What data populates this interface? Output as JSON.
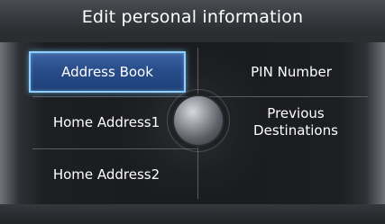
{
  "header": {
    "title": "Edit personal information"
  },
  "menu": {
    "items": [
      {
        "label": "Address Book",
        "selected": true
      },
      {
        "label": "PIN Number",
        "selected": false
      },
      {
        "label": "Home Address1",
        "selected": false
      },
      {
        "label": "Previous Destinations",
        "selected": false
      },
      {
        "label": "Home Address2",
        "selected": false
      }
    ]
  },
  "colors": {
    "selected_fill": "#2a4f8c",
    "selected_border": "#8fd0ff",
    "text": "#ffffff"
  },
  "icons": {
    "knob": "joystick-knob-icon"
  }
}
